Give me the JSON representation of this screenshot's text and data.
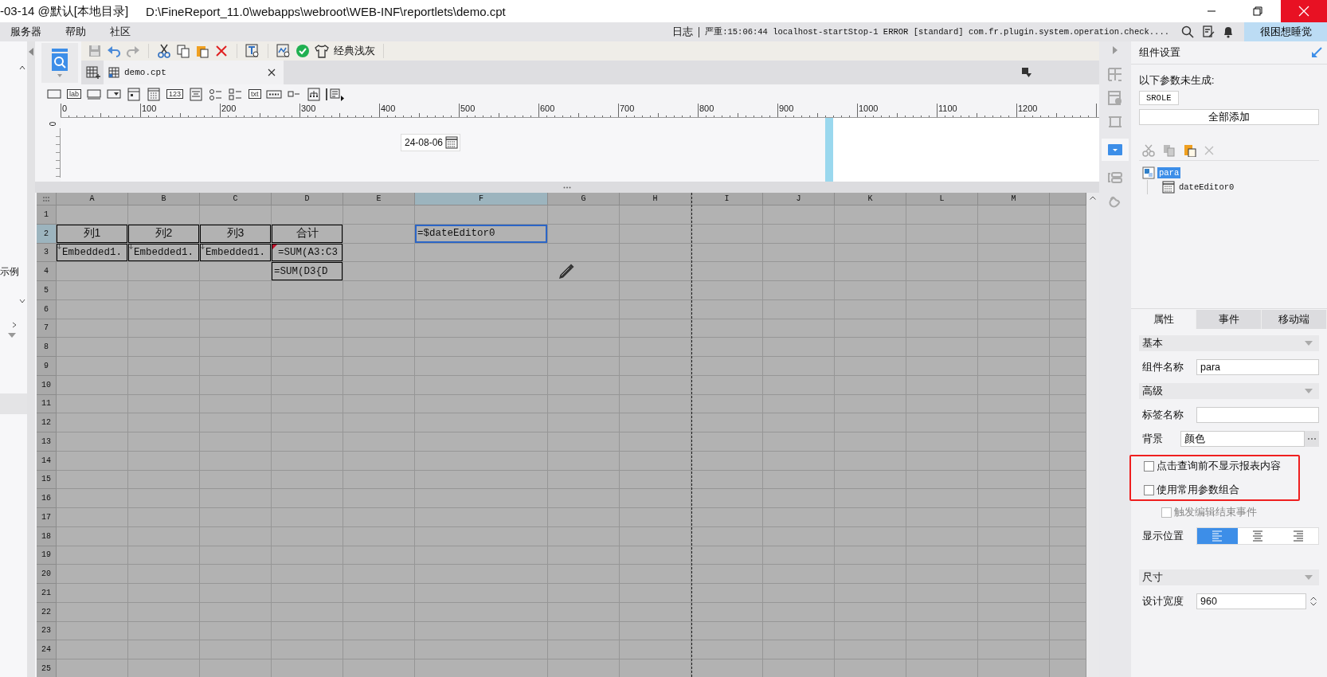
{
  "window": {
    "title": "-03-14 @默认[本地目录]",
    "path": "D:\\FineReport_11.0\\webapps\\webroot\\WEB-INF\\reportlets\\demo.cpt"
  },
  "menu": [
    "服务器",
    "帮助",
    "社区"
  ],
  "log": {
    "label": "日志",
    "message": "严重:15:06:44 localhost-startStop-1 ERROR [standard] com.fr.plugin.system.operation.check...."
  },
  "user": "很困想睡觉",
  "left_panel": {
    "item": "示例"
  },
  "toolbar": {
    "theme": "经典浅灰"
  },
  "tabs": [
    {
      "label": "demo.cpt",
      "selected": true
    }
  ],
  "widget_palette": [
    {
      "kind": "button"
    },
    {
      "kind": "glyph",
      "glyph": "lab"
    },
    {
      "kind": "field"
    },
    {
      "kind": "combo"
    },
    {
      "kind": "form"
    },
    {
      "kind": "date"
    },
    {
      "kind": "glyph",
      "glyph": "123"
    },
    {
      "kind": "textarea"
    },
    {
      "kind": "radio"
    },
    {
      "kind": "checklist"
    },
    {
      "kind": "glyph",
      "glyph": "txt"
    },
    {
      "kind": "password"
    },
    {
      "kind": "checkbox"
    },
    {
      "kind": "tree"
    },
    {
      "kind": "more"
    }
  ],
  "ruler": {
    "ticks": [
      "0",
      "100",
      "200",
      "300",
      "400",
      "500",
      "600",
      "700",
      "800",
      "900",
      "1000",
      "1100",
      "1200"
    ],
    "vertical_ticks": [
      "0"
    ]
  },
  "parameter_pane": {
    "date_value": "24-08-06"
  },
  "sheet": {
    "columns": [
      {
        "label": "A",
        "selected": false
      },
      {
        "label": "B",
        "selected": false
      },
      {
        "label": "C",
        "selected": false
      },
      {
        "label": "D",
        "selected": false
      },
      {
        "label": "E",
        "selected": false
      },
      {
        "label": "F",
        "selected": true
      },
      {
        "label": "G",
        "selected": false
      },
      {
        "label": "H",
        "selected": false
      },
      {
        "label": "I",
        "selected": false
      },
      {
        "label": "J",
        "selected": false
      },
      {
        "label": "K",
        "selected": false
      },
      {
        "label": "L",
        "selected": false
      },
      {
        "label": "M",
        "selected": false
      }
    ],
    "rows": [
      {
        "label": "1",
        "selected": false
      },
      {
        "label": "2",
        "selected": true,
        "cells": [
          {
            "text": "列1",
            "kind": "header",
            "bordered": true,
            "flagged": false,
            "selected": false
          },
          {
            "text": "列2",
            "kind": "header",
            "bordered": true,
            "flagged": false,
            "selected": false
          },
          {
            "text": "列3",
            "kind": "header",
            "bordered": true,
            "flagged": false,
            "selected": false
          },
          {
            "text": "合计",
            "kind": "header",
            "bordered": true,
            "flagged": false,
            "selected": false
          },
          {},
          {
            "text": "=$dateEditor0",
            "kind": "formula",
            "bordered": false,
            "flagged": false,
            "selected": true
          }
        ]
      },
      {
        "label": "3",
        "selected": false,
        "cells": [
          {
            "text": "Embedded1.",
            "kind": "expand",
            "bordered": true,
            "flagged": false,
            "selected": false
          },
          {
            "text": "Embedded1.",
            "kind": "expand",
            "bordered": true,
            "flagged": false,
            "selected": false
          },
          {
            "text": "Embedded1.",
            "kind": "expand",
            "bordered": true,
            "flagged": false,
            "selected": false
          },
          {
            "text": "=SUM(A3:C3",
            "kind": "formula",
            "bordered": true,
            "flagged": true,
            "selected": false
          }
        ]
      },
      {
        "label": "4",
        "selected": false,
        "cells": [
          {},
          {},
          {},
          {
            "text": "=SUM(D3{D",
            "kind": "formula",
            "bordered": true,
            "flagged": false,
            "selected": false
          }
        ]
      },
      {
        "label": "5",
        "selected": false
      },
      {
        "label": "6",
        "selected": false
      },
      {
        "label": "7",
        "selected": false
      },
      {
        "label": "8",
        "selected": false
      },
      {
        "label": "9",
        "selected": false
      },
      {
        "label": "10",
        "selected": false
      },
      {
        "label": "11",
        "selected": false
      },
      {
        "label": "12",
        "selected": false
      },
      {
        "label": "13",
        "selected": false
      },
      {
        "label": "14",
        "selected": false
      },
      {
        "label": "15",
        "selected": false
      },
      {
        "label": "16",
        "selected": false
      },
      {
        "label": "17",
        "selected": false
      },
      {
        "label": "18",
        "selected": false
      },
      {
        "label": "19",
        "selected": false
      },
      {
        "label": "20",
        "selected": false
      },
      {
        "label": "21",
        "selected": false
      },
      {
        "label": "22",
        "selected": false
      },
      {
        "label": "23",
        "selected": false
      },
      {
        "label": "24",
        "selected": false
      },
      {
        "label": "25",
        "selected": false
      }
    ]
  },
  "settings": {
    "title": "组件设置",
    "notice": "以下参数未生成:",
    "missing_params": [
      "SROLE"
    ],
    "add_all": "全部添加",
    "tree": [
      {
        "label": "para",
        "kind": "form",
        "selected": true,
        "children": [
          {
            "label": "dateEditor0",
            "kind": "date",
            "selected": false
          }
        ]
      }
    ]
  },
  "property_tabs": [
    {
      "label": "属性",
      "selected": true
    },
    {
      "label": "事件",
      "selected": false
    },
    {
      "label": "移动端",
      "selected": false
    }
  ],
  "properties": [
    {
      "kind": "section",
      "label": "基本"
    },
    {
      "kind": "field",
      "label": "组件名称",
      "value": "para"
    },
    {
      "kind": "section",
      "label": "高级"
    },
    {
      "kind": "field",
      "label": "标签名称"
    },
    {
      "kind": "picker",
      "label": "背景",
      "value": "颜色"
    },
    {
      "kind": "highlight",
      "children": [
        {
          "kind": "checkbox",
          "label": "点击查询前不显示报表内容",
          "checked": false,
          "disabled": false
        },
        {
          "kind": "checkbox",
          "label": "使用常用参数组合",
          "checked": false,
          "disabled": false
        }
      ]
    },
    {
      "kind": "checkbox",
      "label": "触发编辑结束事件",
      "checked": false,
      "disabled": true
    },
    {
      "kind": "align",
      "label": "显示位置",
      "options": [
        {
          "kind": "left",
          "selected": true
        },
        {
          "kind": "center",
          "selected": false
        },
        {
          "kind": "right",
          "selected": false
        }
      ]
    },
    {
      "kind": "section",
      "label": "尺寸"
    },
    {
      "kind": "spinner",
      "label": "设计宽度",
      "value": "960"
    }
  ]
}
